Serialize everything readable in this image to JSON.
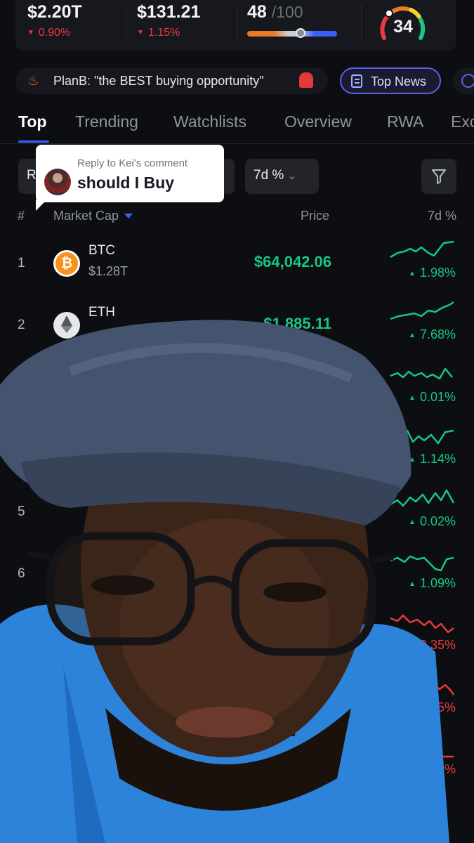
{
  "stats": {
    "market_cap": {
      "value": "$2.20T",
      "change": "0.90%"
    },
    "volume": {
      "value": "$131.21",
      "change": "1.15%"
    },
    "fear_greed": {
      "value": "48",
      "max": "/100",
      "level": 0.48
    },
    "altcoin_gauge": {
      "value": "34"
    }
  },
  "ticker": {
    "text": "PlanB: \"the BEST buying opportunity\""
  },
  "top_news": {
    "label": "Top News"
  },
  "tabs": [
    "Top",
    "Trending",
    "Watchlists",
    "Overview",
    "RWA",
    "Exc"
  ],
  "filters": {
    "left_label": "R",
    "period_label": "7d %"
  },
  "reply": {
    "caption": "Reply to Kei's comment",
    "text": "should I Buy"
  },
  "columns": {
    "rank": "#",
    "market_cap": "Market Cap",
    "price": "Price",
    "change": "7d %"
  },
  "rows": [
    {
      "rank": "1",
      "symbol": "BTC",
      "market_cap": "$1.28T",
      "price": "$64,042.06",
      "change": "1.98%",
      "direction": "up"
    },
    {
      "rank": "2",
      "symbol": "ETH",
      "market_cap": "",
      "price": "$1,885.11",
      "change": "7.68%",
      "direction": "up"
    },
    {
      "rank": "",
      "symbol": "",
      "market_cap": "",
      "price": "",
      "change": "0.01%",
      "direction": "up"
    },
    {
      "rank": "",
      "symbol": "",
      "market_cap": "",
      "price": "",
      "change": "1.14%",
      "direction": "up"
    },
    {
      "rank": "5",
      "symbol": "",
      "market_cap": "",
      "price": "",
      "change": "0.02%",
      "direction": "up"
    },
    {
      "rank": "6",
      "symbol": "",
      "market_cap": "",
      "price": "",
      "change": "1.09%",
      "direction": "up"
    },
    {
      "rank": "",
      "symbol": "",
      "market_cap": "",
      "price": "",
      "change": "2.35%",
      "direction": "down"
    },
    {
      "rank": "",
      "symbol": "",
      "market_cap": "",
      "price": "",
      "change": "2.25%",
      "direction": "down"
    },
    {
      "rank": "",
      "symbol": "",
      "market_cap": "",
      "price": "",
      "change": "8%",
      "direction": "down"
    }
  ],
  "colors": {
    "up": "#16c784",
    "down": "#ea3943",
    "accent": "#3861fb",
    "background": "#0d0e12"
  }
}
